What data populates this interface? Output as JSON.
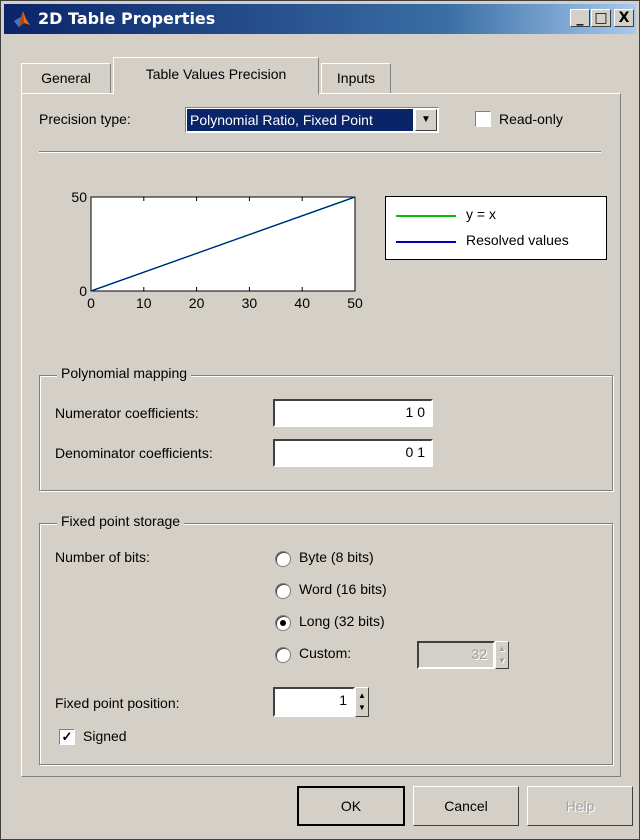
{
  "window": {
    "title": "2D Table Properties"
  },
  "titlebar_buttons": {
    "minimize": "_",
    "maximize": "□",
    "close": "X"
  },
  "tabs": [
    {
      "label": "General",
      "active": false
    },
    {
      "label": "Table Values Precision",
      "active": true
    },
    {
      "label": "Inputs",
      "active": false
    }
  ],
  "precision": {
    "label": "Precision type:",
    "value": "Polynomial Ratio, Fixed Point",
    "readonly_label": "Read-only",
    "readonly_checked": false
  },
  "chart_data": {
    "type": "line",
    "xlim": [
      0,
      50
    ],
    "ylim": [
      0,
      50
    ],
    "x_ticks": [
      "0",
      "10",
      "20",
      "30",
      "40",
      "50"
    ],
    "y_ticks": [
      "0",
      "50"
    ],
    "grid": false,
    "legend_position": "right",
    "series": [
      {
        "name": "y = x",
        "color": "#00c000",
        "x": [
          0,
          50
        ],
        "y": [
          0,
          50
        ]
      },
      {
        "name": "Resolved values",
        "color": "#0000c0",
        "x": [
          0,
          50
        ],
        "y": [
          0,
          50
        ]
      }
    ]
  },
  "polynomial": {
    "title": "Polynomial mapping",
    "numerator_label": "Numerator coefficients:",
    "numerator_value": "1 0",
    "denominator_label": "Denominator coefficients:",
    "denominator_value": "0 1"
  },
  "storage": {
    "title": "Fixed point storage",
    "bits_label": "Number of bits:",
    "options": [
      {
        "label": "Byte (8 bits)",
        "selected": false
      },
      {
        "label": "Word (16 bits)",
        "selected": false
      },
      {
        "label": "Long (32 bits)",
        "selected": true
      },
      {
        "label": "Custom:",
        "selected": false
      }
    ],
    "custom_value": "32",
    "position_label": "Fixed point position:",
    "position_value": "1",
    "signed_label": "Signed",
    "signed_checked": true
  },
  "buttons": {
    "ok": "OK",
    "cancel": "Cancel",
    "help": "Help"
  },
  "icons": {
    "app": "matlab-logo-icon",
    "checkmark": "✓"
  }
}
